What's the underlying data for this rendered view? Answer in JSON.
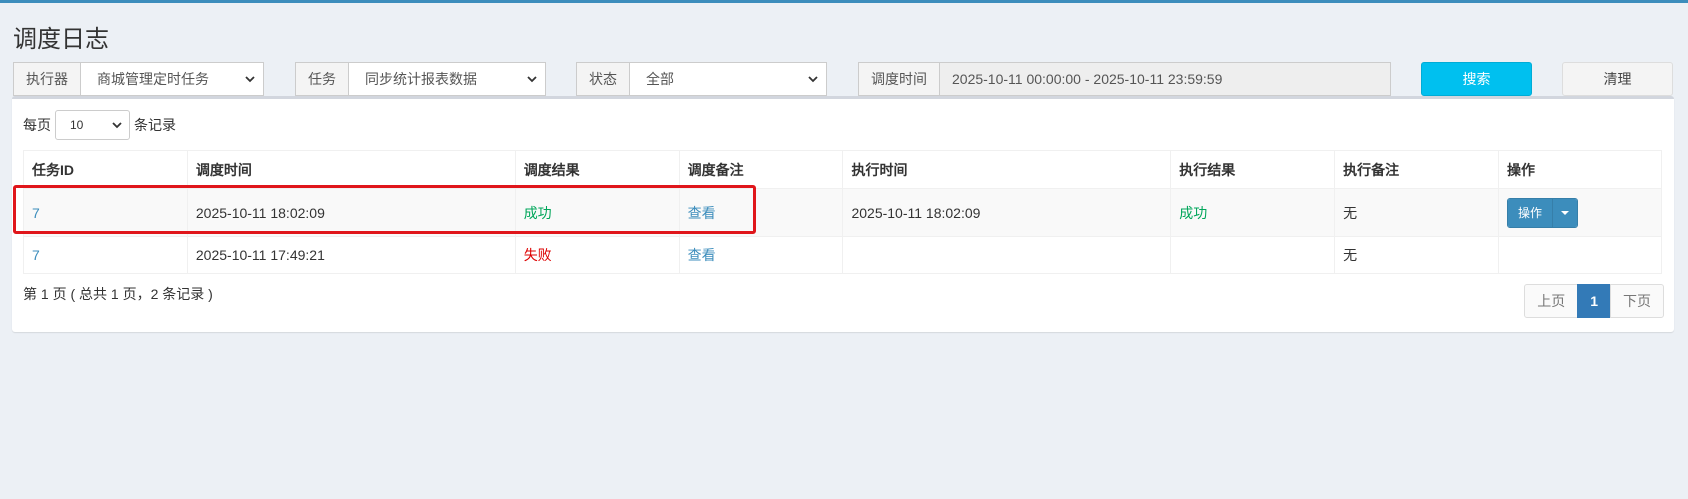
{
  "page": {
    "title": "调度日志"
  },
  "filters": {
    "executor": {
      "label": "执行器",
      "value": "商城管理定时任务"
    },
    "task": {
      "label": "任务",
      "value": "同步统计报表数据"
    },
    "status": {
      "label": "状态",
      "value": "全部"
    },
    "time": {
      "label": "调度时间",
      "value": "2025-10-11 00:00:00 - 2025-10-11 23:59:59"
    },
    "search_label": "搜索",
    "clear_label": "清理"
  },
  "perpage": {
    "prefix": "每页",
    "value": "10",
    "suffix": "条记录"
  },
  "table": {
    "headers": [
      "任务ID",
      "调度时间",
      "调度结果",
      "调度备注",
      "执行时间",
      "执行结果",
      "执行备注",
      "操作"
    ],
    "rows": [
      {
        "id": "7",
        "trigger_time": "2025-10-11 18:02:09",
        "trigger_result": "成功",
        "trigger_msg": "查看",
        "handle_time": "2025-10-11 18:02:09",
        "handle_result": "成功",
        "handle_msg": "无",
        "action": "操作"
      },
      {
        "id": "7",
        "trigger_time": "2025-10-11 17:49:21",
        "trigger_result": "失败",
        "trigger_msg": "查看",
        "handle_time": "",
        "handle_result": "",
        "handle_msg": "无",
        "action": ""
      }
    ]
  },
  "summary": "第 1 页 ( 总共 1 页，2 条记录 )",
  "pager": {
    "prev": "上页",
    "current": "1",
    "next": "下页"
  },
  "colors": {
    "accent": "#3c8dbc",
    "search": "#00c0ef",
    "success": "#00a65a",
    "fail": "#dd0000",
    "highlight": "#e0161b"
  }
}
